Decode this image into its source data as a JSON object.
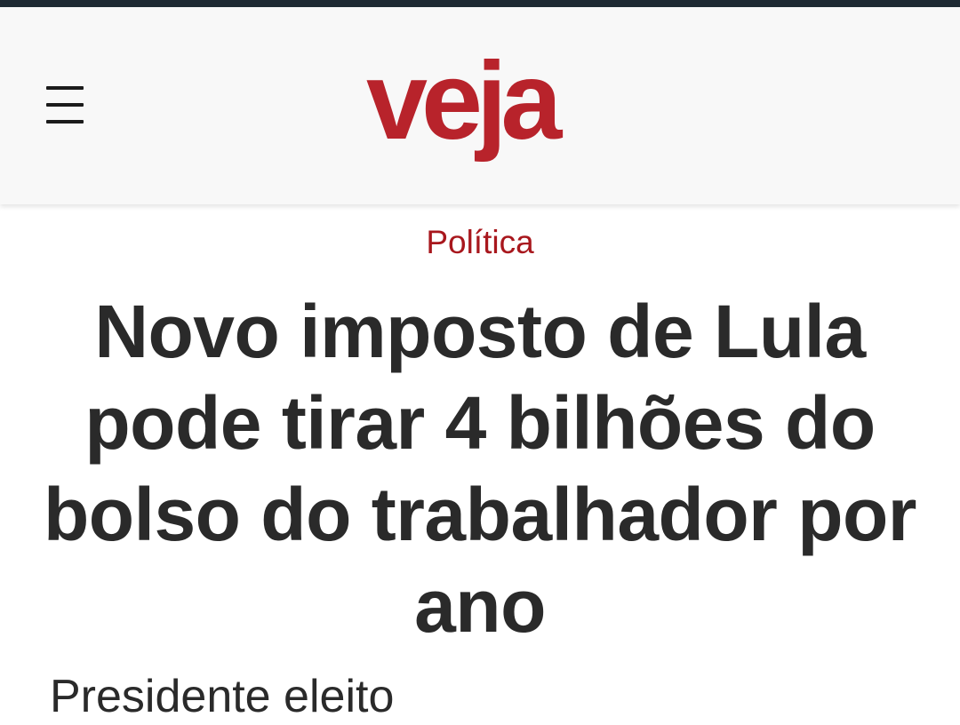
{
  "app": {
    "status_strip_color": "#1f2a33"
  },
  "header": {
    "menu_icon": "hamburger-menu-icon",
    "logo_text": "veja",
    "logo_color": "#b8232b",
    "background": "#f8f8f8"
  },
  "article": {
    "category": "Política",
    "category_color": "#a8171d",
    "headline": "Novo imposto de Lula pode tirar 4 bilhões do bolso do trabalhador por ano",
    "headline_color": "#2a2a2a",
    "subheadline_partial": "Presidente eleito"
  }
}
